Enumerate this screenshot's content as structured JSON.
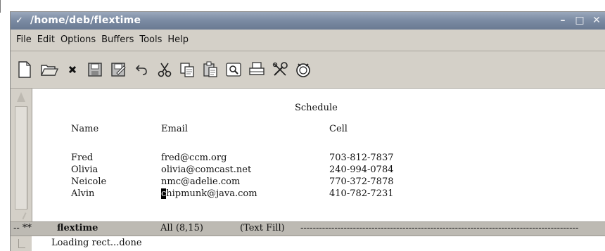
{
  "window": {
    "title": "/home/deb/flextime",
    "menu_icon": "chevron-down-icon",
    "controls": {
      "minimize": "–",
      "maximize": "□",
      "close": "✕"
    }
  },
  "menubar": {
    "items": [
      "File",
      "Edit",
      "Options",
      "Buffers",
      "Tools",
      "Help"
    ]
  },
  "toolbar": {
    "icons": [
      "new-file-icon",
      "open-folder-icon",
      "close-icon",
      "save-icon",
      "save-as-icon",
      "undo-icon",
      "cut-icon",
      "copy-icon",
      "paste-icon",
      "search-icon",
      "print-icon",
      "tools-icon",
      "info-icon"
    ]
  },
  "buffer": {
    "title": "Schedule",
    "headers": [
      "Name",
      "Email",
      "Cell"
    ],
    "rows": [
      {
        "name": "Fred",
        "email": "fred@ccm.org",
        "cell": "703-812-7837"
      },
      {
        "name": "Olivia",
        "email": "olivia@comcast.net",
        "cell": "240-994-0784"
      },
      {
        "name": "Neicole",
        "email": "nmc@adelie.com",
        "cell": "770-372-7878"
      },
      {
        "name": "Alvin",
        "email_cursor": "c",
        "email_rest": "hipmunk@java.com",
        "cell": "410-782-7231"
      }
    ]
  },
  "modeline": {
    "prefix": "-- **",
    "buffer_name": "flextime",
    "position": "All (8,15)",
    "mode": "(Text Fill)",
    "fill": "------------------------------------------------------------------------------------------"
  },
  "echo_area": {
    "message": "Loading rect...done"
  }
}
